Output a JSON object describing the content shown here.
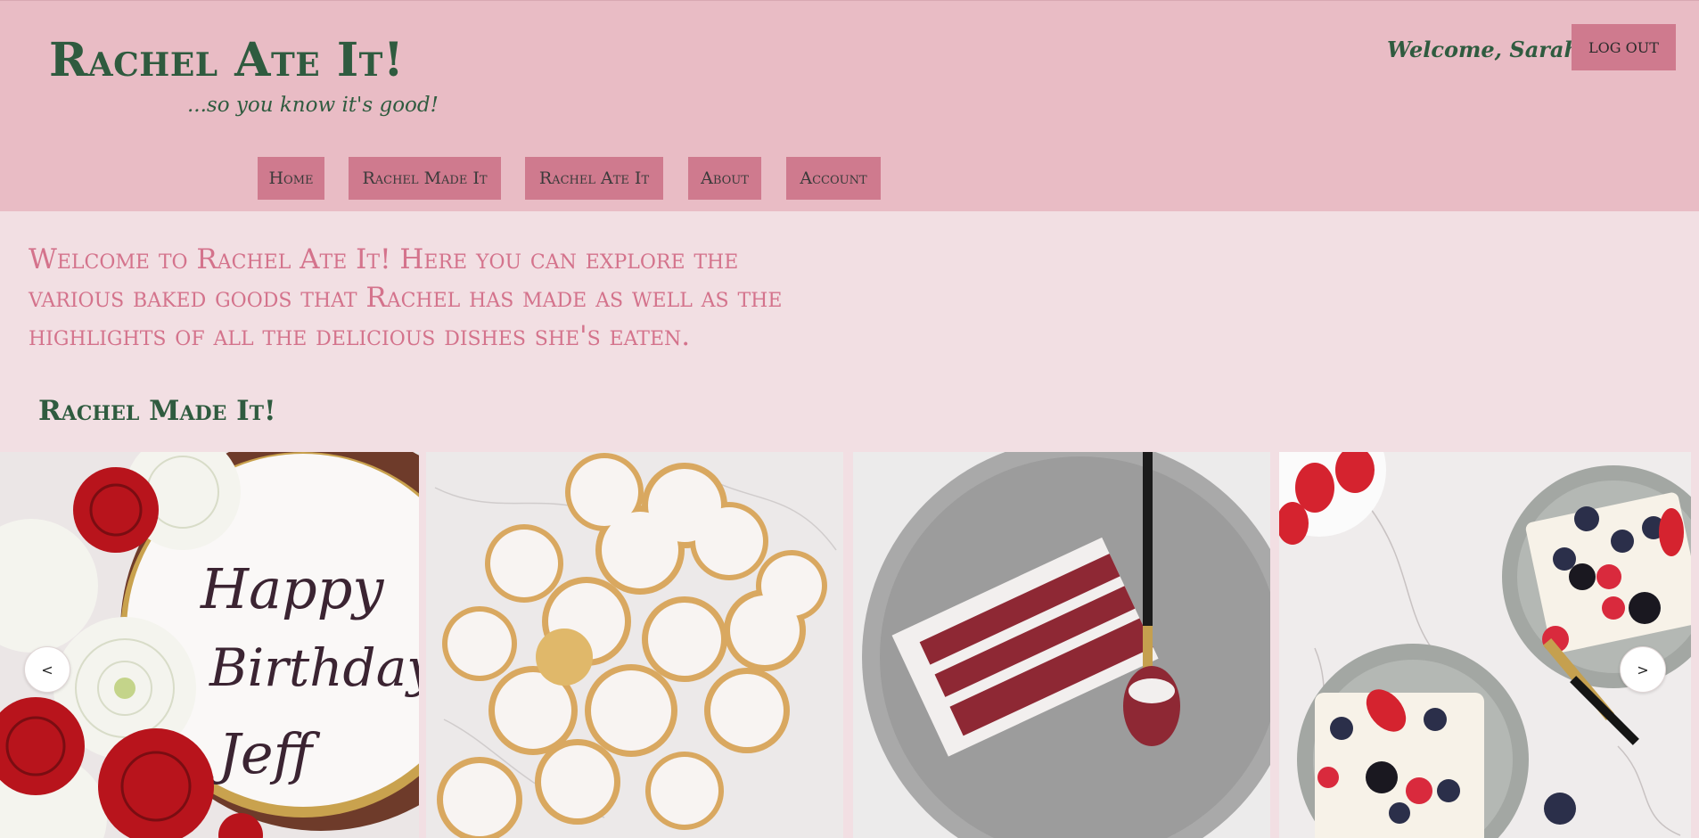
{
  "header": {
    "site_title": "Rachel Ate It!",
    "tagline": "...so you know it's good!",
    "welcome": "Welcome, Sarah!",
    "logout_label": "LOG OUT"
  },
  "nav": {
    "items": [
      {
        "label": "Home"
      },
      {
        "label": "Rachel Made It"
      },
      {
        "label": "Rachel Ate It"
      },
      {
        "label": "About"
      },
      {
        "label": "Account"
      }
    ]
  },
  "main": {
    "intro": "Welcome to Rachel Ate It! Here you can explore the various baked goods that Rachel has made as well as the highlights of all the delicious dishes she's eaten.",
    "section_title": "Rachel Made It!"
  },
  "carousel": {
    "prev_label": "<",
    "next_label": ">",
    "slides": [
      {
        "image": "birthday-cake-with-roses-and-chrysanthemums",
        "cake_text": "Happy Birthday Jeff"
      },
      {
        "image": "glazed-cookies"
      },
      {
        "image": "red-velvet-cake-slice"
      },
      {
        "image": "berry-dessert-bars"
      }
    ]
  },
  "colors": {
    "header_bg": "#e9bcc5",
    "body_bg": "#f2dfe3",
    "button_bg": "#cf7a8e",
    "title_green": "#2f5b3f",
    "intro_pink": "#d4738c"
  }
}
